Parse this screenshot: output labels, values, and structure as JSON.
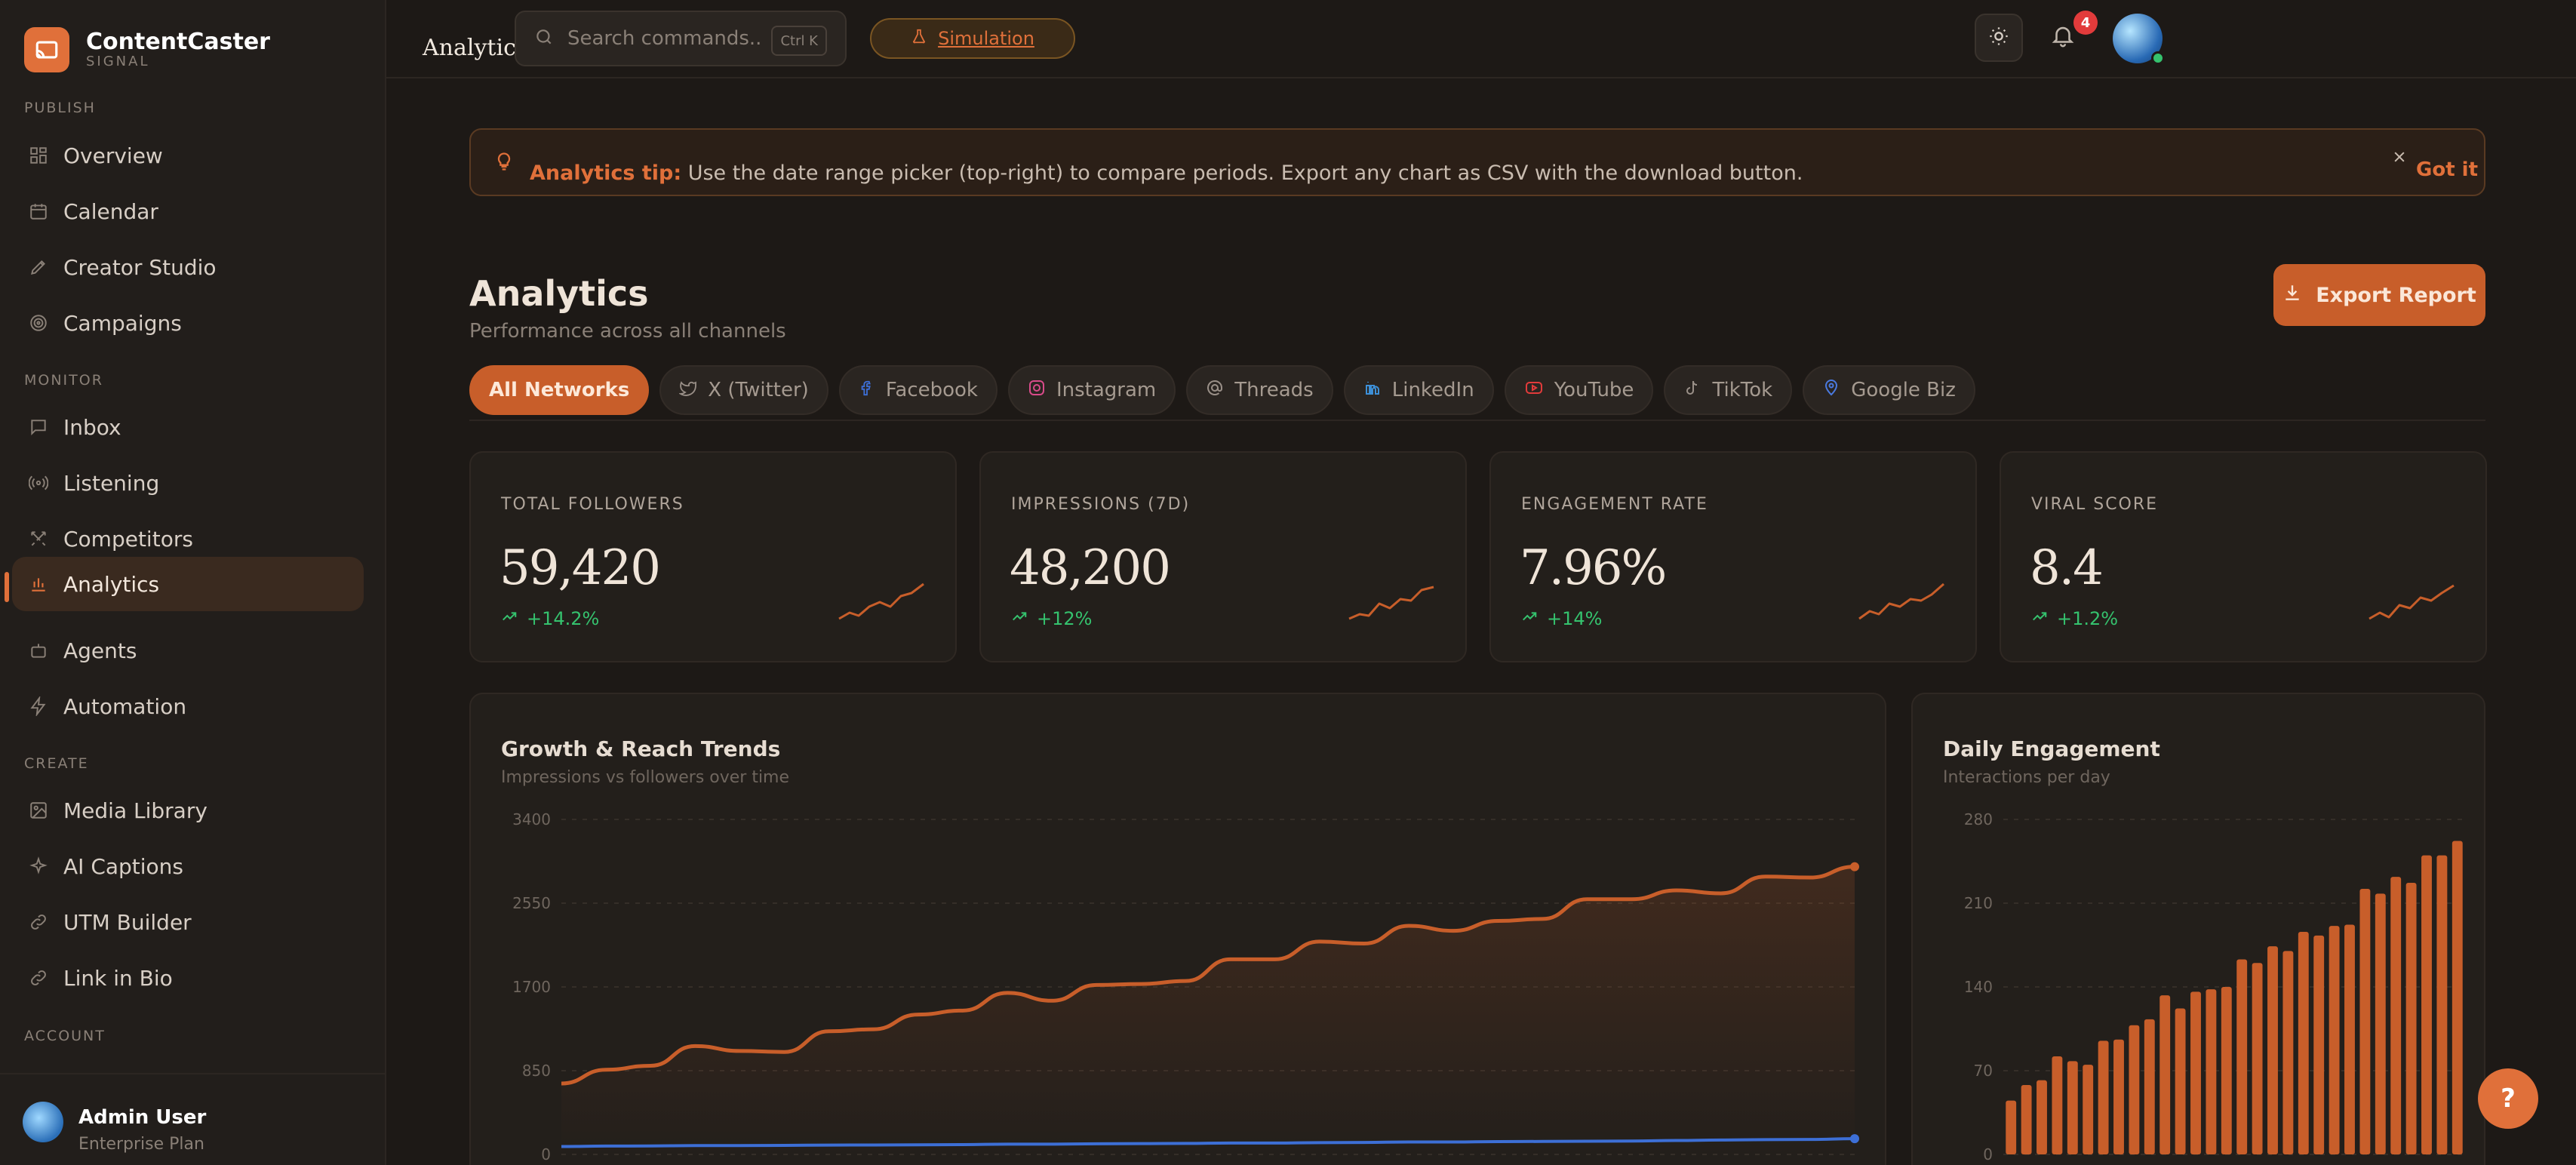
{
  "brand": {
    "name": "ContentCaster",
    "sub": "SIGNAL"
  },
  "sidebar": {
    "sections": [
      {
        "label": "PUBLISH"
      },
      {
        "label": "MONITOR"
      },
      {
        "label": "CREATE"
      },
      {
        "label": "ACCOUNT"
      }
    ],
    "items": [
      {
        "label": "Overview",
        "icon": "grid-icon"
      },
      {
        "label": "Calendar",
        "icon": "calendar-icon"
      },
      {
        "label": "Creator Studio",
        "icon": "pen-icon"
      },
      {
        "label": "Campaigns",
        "icon": "target-icon"
      },
      {
        "label": "Inbox",
        "icon": "message-icon"
      },
      {
        "label": "Listening",
        "icon": "broadcast-icon"
      },
      {
        "label": "Competitors",
        "icon": "swords-icon"
      },
      {
        "label": "Analytics",
        "icon": "bar-chart-icon",
        "active": true
      },
      {
        "label": "Agents",
        "icon": "bot-icon"
      },
      {
        "label": "Automation",
        "icon": "bolt-icon"
      },
      {
        "label": "Media Library",
        "icon": "image-icon"
      },
      {
        "label": "AI Captions",
        "icon": "sparkle-icon"
      },
      {
        "label": "UTM Builder",
        "icon": "link-icon"
      },
      {
        "label": "Link in Bio",
        "icon": "link-icon"
      }
    ]
  },
  "user": {
    "name": "Admin User",
    "plan": "Enterprise Plan"
  },
  "topbar": {
    "crumb": "Analytics",
    "search_placeholder": "Search commands...",
    "shortcut": "Ctrl K",
    "simulation": "Simulation",
    "notifications": "4"
  },
  "tip": {
    "title": "Analytics tip:",
    "body": "Use the date range picker (top-right) to compare periods. Export any chart as CSV with the download button.",
    "dismiss": "Got it"
  },
  "page": {
    "title": "Analytics",
    "subtitle": "Performance across all channels",
    "export_label": "Export Report"
  },
  "tabs": [
    {
      "label": "All Networks",
      "icon": "",
      "active": true
    },
    {
      "label": "X (Twitter)",
      "icon": "twitter-icon"
    },
    {
      "label": "Facebook",
      "icon": "facebook-icon"
    },
    {
      "label": "Instagram",
      "icon": "instagram-icon"
    },
    {
      "label": "Threads",
      "icon": "threads-icon"
    },
    {
      "label": "LinkedIn",
      "icon": "linkedin-icon"
    },
    {
      "label": "YouTube",
      "icon": "youtube-icon"
    },
    {
      "label": "TikTok",
      "icon": "tiktok-icon"
    },
    {
      "label": "Google Biz",
      "icon": "map-pin-icon"
    }
  ],
  "kpis": [
    {
      "label": "TOTAL FOLLOWERS",
      "value": "59,420",
      "change": "+14.2%"
    },
    {
      "label": "IMPRESSIONS (7D)",
      "value": "48,200",
      "change": "+12%"
    },
    {
      "label": "ENGAGEMENT RATE",
      "value": "7.96%",
      "change": "+14%"
    },
    {
      "label": "VIRAL SCORE",
      "value": "8.4",
      "change": "+1.2%"
    }
  ],
  "colors": {
    "accent": "#e0703a",
    "secondary": "#3d6fd6",
    "positive": "#35c26e"
  },
  "chart_data": [
    {
      "type": "line",
      "title": "Growth & Reach Trends",
      "subtitle": "Impressions vs followers over time",
      "ylim": [
        0,
        3400
      ],
      "yticks": [
        0,
        850,
        1700,
        2550,
        3400
      ],
      "grid": true,
      "series": [
        {
          "color": "#c85e2a",
          "values": [
            720,
            860,
            900,
            1100,
            1050,
            1040,
            1250,
            1270,
            1420,
            1460,
            1640,
            1560,
            1720,
            1730,
            1760,
            1980,
            1980,
            2160,
            2140,
            2320,
            2270,
            2370,
            2390,
            2590,
            2590,
            2680,
            2650,
            2820,
            2810,
            2920
          ]
        },
        {
          "color": "#3d6fd6",
          "values": [
            80,
            85,
            86,
            90,
            90,
            92,
            95,
            96,
            98,
            100,
            104,
            104,
            108,
            110,
            112,
            116,
            116,
            120,
            122,
            126,
            126,
            130,
            132,
            134,
            136,
            142,
            146,
            150,
            152,
            160
          ]
        }
      ]
    },
    {
      "type": "bar",
      "title": "Daily Engagement",
      "subtitle": "Interactions per day",
      "ylim": [
        0,
        280
      ],
      "yticks": [
        0,
        70,
        140,
        210,
        280
      ],
      "series": [
        {
          "color": "#c85e2a",
          "values": [
            45,
            58,
            62,
            82,
            78,
            75,
            95,
            96,
            108,
            113,
            133,
            122,
            136,
            138,
            140,
            163,
            160,
            174,
            170,
            186,
            183,
            191,
            192,
            222,
            218,
            232,
            227,
            250,
            250,
            262
          ]
        }
      ]
    }
  ]
}
